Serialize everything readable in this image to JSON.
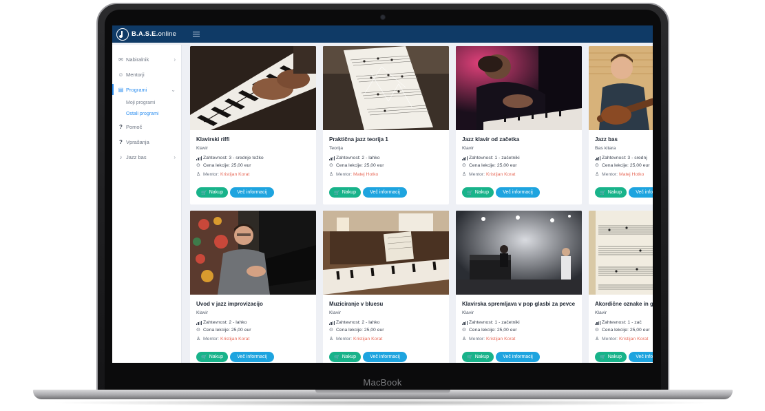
{
  "device": {
    "brand_label": "MacBook"
  },
  "app": {
    "logo_bold": "B.A.S.E.",
    "logo_thin": "online"
  },
  "colors": {
    "topbar": "#0f3a66",
    "accent": "#2d8ff0",
    "buy": "#18b38a",
    "info": "#1ea4df",
    "mentor_link": "#e76b5a"
  },
  "sidebar": {
    "items": [
      {
        "label": "Nabiralnik",
        "icon": "inbox-icon"
      },
      {
        "label": "Mentorji",
        "icon": "users-icon"
      },
      {
        "label": "Programi",
        "icon": "book-icon"
      },
      {
        "label": "Pomoč",
        "icon": "question-icon"
      },
      {
        "label": "Vprašanja",
        "icon": "question-icon"
      },
      {
        "label": "Jazz bas",
        "icon": "guitar-icon"
      }
    ],
    "subitems": [
      {
        "label": "Moji programi"
      },
      {
        "label": "Ostali programi"
      }
    ]
  },
  "labels": {
    "difficulty_prefix": "Zahtevnost:",
    "price_prefix": "Cena lekcije:",
    "mentor_prefix": "Mentor:",
    "buy_button": "Nakup",
    "info_button": "Več informacij"
  },
  "courses": [
    {
      "title": "Klavirski riffi",
      "category": "Klavir",
      "difficulty": "3 - srednje težko",
      "price": "25,00 eur",
      "mentor": "Kristijan Korat",
      "thumb": "piano-hands-photo"
    },
    {
      "title": "Praktična jazz teorija 1",
      "category": "Teorija",
      "difficulty": "2 - lahko",
      "price": "25,00 eur",
      "mentor": "Matej Hotko",
      "thumb": "sheet-music-photo"
    },
    {
      "title": "Jazz klavir od začetka",
      "category": "Klavir",
      "difficulty": "1 - začetniki",
      "price": "25,00 eur",
      "mentor": "Kristijan Korat",
      "thumb": "stage-pianist-photo"
    },
    {
      "title": "Jazz bas",
      "category": "Bas kitara",
      "difficulty": "3 - srednj",
      "price": "25,00 eur",
      "mentor": "Matej Hotko",
      "thumb": "bass-player-photo"
    },
    {
      "title": "Uvod v jazz improvizacijo",
      "category": "Klavir",
      "difficulty": "2 - lahko",
      "price": "25,00 eur",
      "mentor": "Kristijan Korat",
      "thumb": "teacher-at-piano-photo"
    },
    {
      "title": "Muziciranje v bluesu",
      "category": "Klavir",
      "difficulty": "2 - lahko",
      "price": "25,00 eur",
      "mentor": "Kristijan Korat",
      "thumb": "upright-piano-photo"
    },
    {
      "title": "Klavirska spremljava v pop glasbi za pevce",
      "category": "Klavir",
      "difficulty": "1 - začetniki",
      "price": "25,00 eur",
      "mentor": "Kristijan Korat",
      "thumb": "concert-stage-photo"
    },
    {
      "title": "Akordične oznake in gr",
      "category": "Klavir",
      "difficulty": "1 - zač",
      "price": "25,00 eur",
      "mentor": "Kristijan Korat",
      "thumb": "chord-chart-photo"
    }
  ]
}
